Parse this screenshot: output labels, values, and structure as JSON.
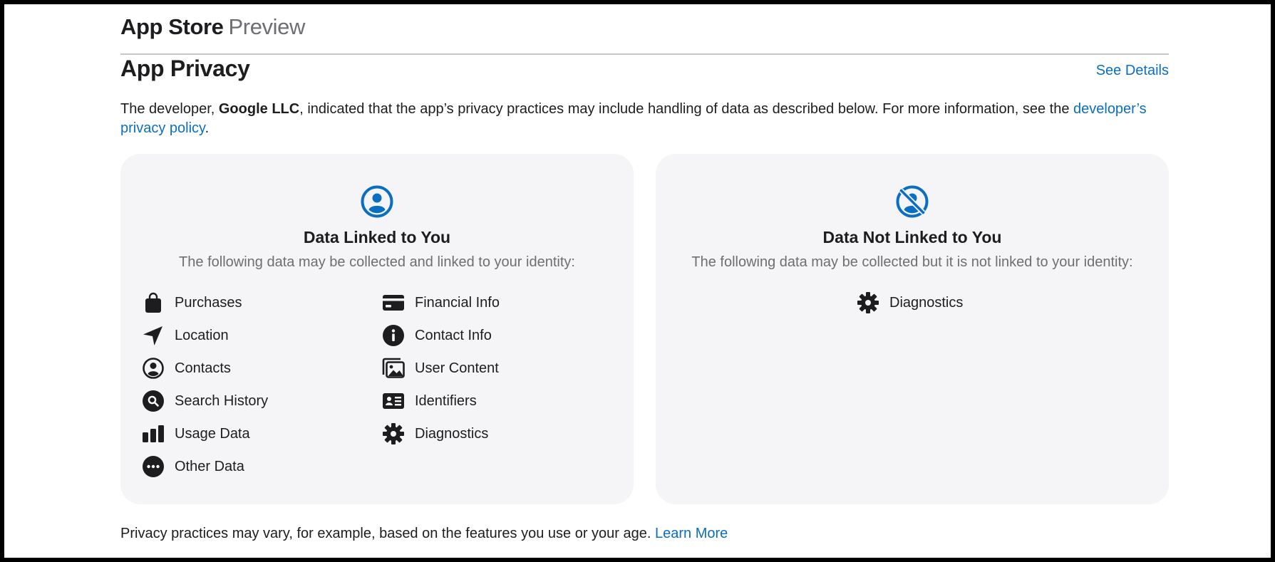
{
  "header": {
    "brand_strong": "App Store",
    "brand_light": "Preview"
  },
  "privacy": {
    "title": "App Privacy",
    "see_details": "See Details",
    "intro_prefix": "The developer, ",
    "developer": "Google LLC",
    "intro_suffix": ", indicated that the app’s privacy practices may include handling of data as described below. For more information, see the ",
    "policy_link": "developer’s privacy policy",
    "intro_end": ".",
    "accent_color": "#0a6fc2"
  },
  "linked": {
    "icon": "person-circle-icon",
    "title": "Data Linked to You",
    "subtitle": "The following data may be collected and linked to your identity:",
    "items": [
      {
        "label": "Purchases",
        "icon": "shopping-bag-icon"
      },
      {
        "label": "Financial Info",
        "icon": "credit-card-icon"
      },
      {
        "label": "Location",
        "icon": "location-arrow-icon"
      },
      {
        "label": "Contact Info",
        "icon": "info-circle-icon"
      },
      {
        "label": "Contacts",
        "icon": "person-circle-icon"
      },
      {
        "label": "User Content",
        "icon": "photos-icon"
      },
      {
        "label": "Search History",
        "icon": "magnifier-circle-icon"
      },
      {
        "label": "Identifiers",
        "icon": "id-card-icon"
      },
      {
        "label": "Usage Data",
        "icon": "bar-chart-icon"
      },
      {
        "label": "Diagnostics",
        "icon": "gear-icon"
      },
      {
        "label": "Other Data",
        "icon": "ellipsis-circle-icon"
      }
    ]
  },
  "not_linked": {
    "icon": "person-slash-circle-icon",
    "title": "Data Not Linked to You",
    "subtitle": "The following data may be collected but it is not linked to your identity:",
    "items": [
      {
        "label": "Diagnostics",
        "icon": "gear-icon"
      }
    ]
  },
  "footer": {
    "text": "Privacy practices may vary, for example, based on the features you use or your age.",
    "learn_more": "Learn More"
  }
}
